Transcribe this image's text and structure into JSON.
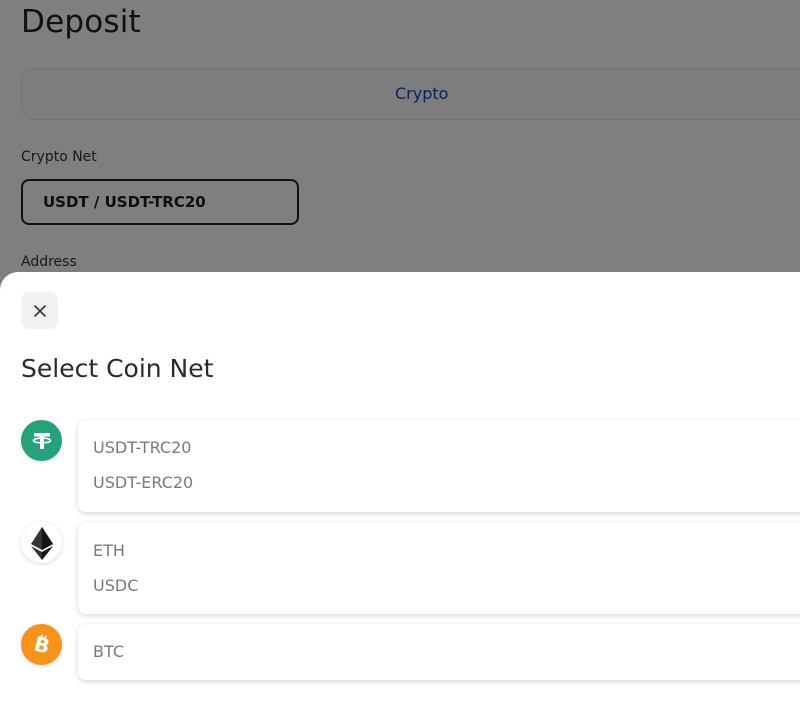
{
  "background": {
    "title": "Deposit",
    "tab_label": "Crypto",
    "crypto_net_label": "Crypto Net",
    "selected_net": "USDT / USDT-TRC20",
    "address_label": "Address"
  },
  "sheet": {
    "title": "Select Coin Net",
    "coins": [
      {
        "icon": "tether-icon",
        "color": "#26a17b",
        "nets": [
          "USDT-TRC20",
          "USDT-ERC20"
        ]
      },
      {
        "icon": "ethereum-icon",
        "color": "#ffffff",
        "nets": [
          "ETH",
          "USDC"
        ]
      },
      {
        "icon": "bitcoin-icon",
        "color": "#f7931a",
        "nets": [
          "BTC"
        ]
      }
    ]
  }
}
